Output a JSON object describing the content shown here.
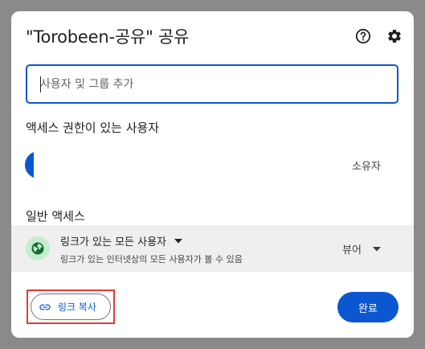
{
  "dialog": {
    "title": "\"Torobeen-공유\" 공유",
    "help_icon": "help-circle-icon",
    "settings_icon": "gear-icon"
  },
  "add_people": {
    "placeholder": "사용자 및 그룹 추가",
    "value": ""
  },
  "people_with_access": {
    "label": "액세스 권한이 있는 사용자",
    "owner_role": "소유자"
  },
  "general_access": {
    "label": "일반 액세스",
    "icon": "globe-icon",
    "access_option": "링크가 있는 모든 사용자",
    "description": "링크가 있는 인터넷상의 모든 사용자가 볼 수 있음",
    "role": "뷰어"
  },
  "footer": {
    "copy_link_label": "링크 복사",
    "copy_link_icon": "link-icon",
    "done_label": "완료"
  },
  "colors": {
    "accent": "#0b57d0",
    "highlight_border": "#e53935",
    "globe_bg": "#c4eed0",
    "globe_fg": "#146c2e"
  }
}
